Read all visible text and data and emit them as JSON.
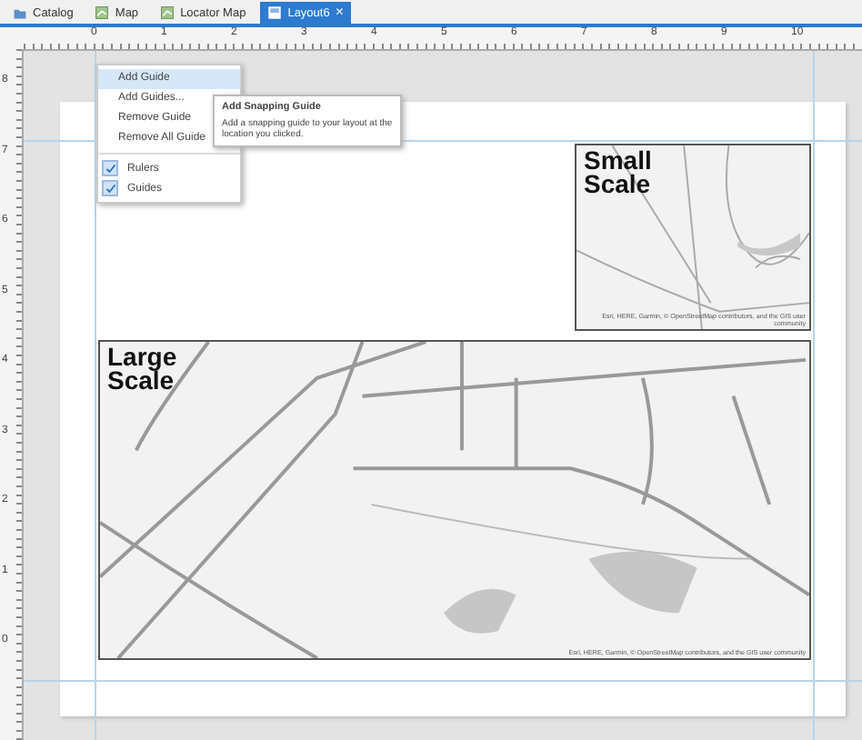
{
  "tabs": [
    {
      "label": "Catalog",
      "kind": "catalog",
      "selected": false
    },
    {
      "label": "Map",
      "kind": "map",
      "selected": false
    },
    {
      "label": "Locator Map",
      "kind": "map",
      "selected": false
    },
    {
      "label": "Layout6",
      "kind": "layout",
      "selected": true,
      "close": "×"
    }
  ],
  "top_ruler": [
    "0",
    "1",
    "2",
    "3",
    "4",
    "5",
    "6",
    "7",
    "8",
    "9",
    "10"
  ],
  "left_ruler": [
    "8",
    "7",
    "6",
    "5",
    "4",
    "3",
    "2",
    "1",
    "0"
  ],
  "context_menu": {
    "items": [
      {
        "label": "Add Guide",
        "kind": "command",
        "selected": true,
        "disabled": false
      },
      {
        "label": "Add Guides...",
        "kind": "command",
        "selected": false,
        "disabled": false
      },
      {
        "label": "Remove Guide",
        "kind": "command",
        "selected": false,
        "disabled": false
      },
      {
        "label": "Remove All Guide",
        "kind": "command",
        "selected": false,
        "disabled": false
      },
      {
        "label": "Rulers",
        "kind": "check",
        "checked": true
      },
      {
        "label": "Guides",
        "kind": "check",
        "checked": true
      }
    ]
  },
  "tooltip": {
    "title": "Add Snapping Guide",
    "text": "Add a snapping guide to your layout at the location you clicked."
  },
  "small_map": {
    "title": "Small Scale",
    "attribution": "Esri, HERE, Garmin, © OpenStreetMap contributors, and the GIS user community"
  },
  "large_map": {
    "title": "Large Scale",
    "attribution": "Esri, HERE, Garmin, © OpenStreetMap contributors, and the GIS user community"
  }
}
